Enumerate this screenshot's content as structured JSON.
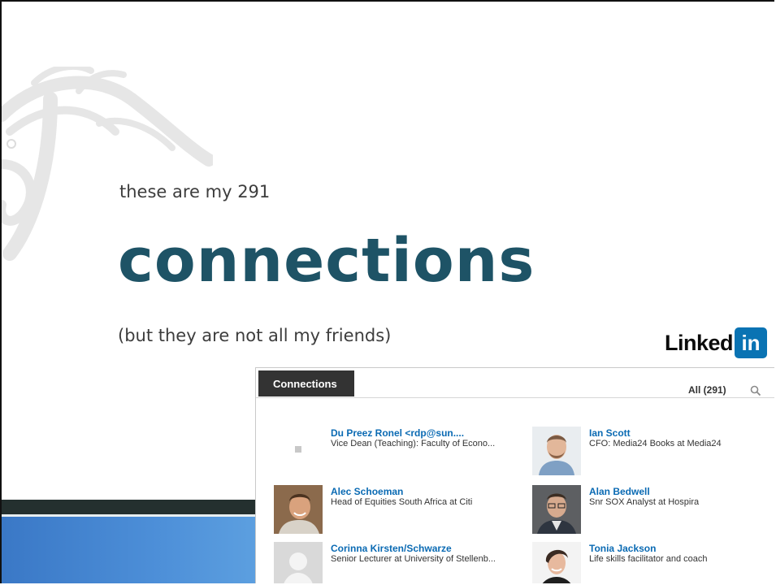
{
  "slide": {
    "subtitle": "these are my 291",
    "title": "connections",
    "aside": "(but they are not all my friends)"
  },
  "logo": {
    "word": "Linked",
    "badge": "in",
    "badge_color": "#0a73b3"
  },
  "panel": {
    "tab_label": "Connections",
    "filter_label": "All (291)",
    "connections": [
      {
        "name": "Du Preez Ronel <rdp@sun....",
        "title": "Vice Dean (Teaching): Faculty of Econo...",
        "avatar": "none"
      },
      {
        "name": "Ian Scott",
        "title": "CFO: Media24 Books at Media24",
        "avatar": "photo"
      },
      {
        "name": "Alec Schoeman",
        "title": "Head of Equities South Africa at Citi",
        "avatar": "photo"
      },
      {
        "name": "Alan Bedwell",
        "title": "Snr SOX Analyst at Hospira",
        "avatar": "photo"
      },
      {
        "name": "Corinna Kirsten/Schwarze",
        "title": "Senior Lecturer at University of Stellenb...",
        "avatar": "placeholder"
      },
      {
        "name": "Tonia Jackson",
        "title": "Life skills facilitator and coach",
        "avatar": "photo"
      }
    ]
  },
  "colors": {
    "title": "#1e5366",
    "link": "#0a6ab3",
    "tab_bg": "#333333"
  }
}
